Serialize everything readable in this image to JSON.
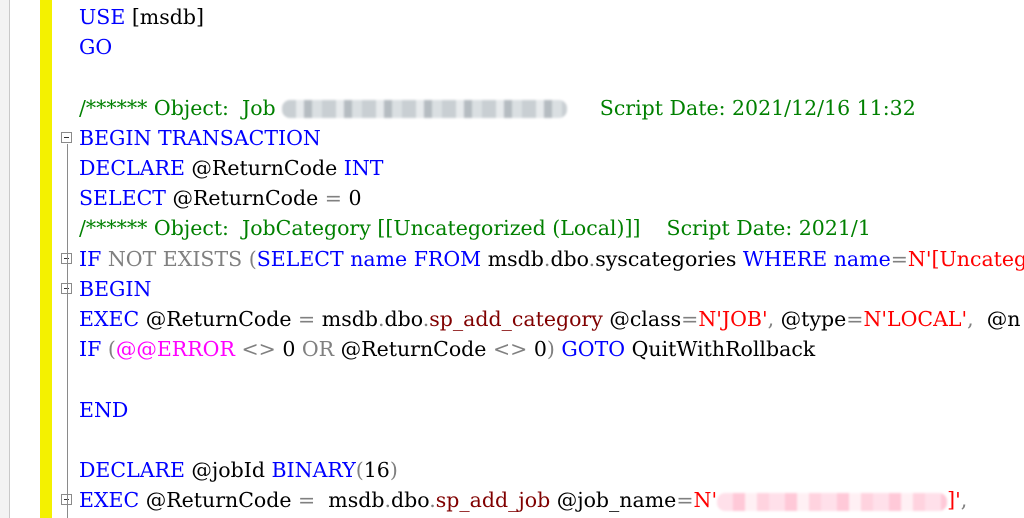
{
  "editor": {
    "lines": [
      {
        "collapse": false,
        "tokens": [
          {
            "text": "USE ",
            "color": "#0000ff"
          },
          {
            "text": "[msdb]",
            "color": "#000000"
          }
        ]
      },
      {
        "collapse": false,
        "tokens": [
          {
            "text": "GO",
            "color": "#0000ff"
          }
        ]
      },
      {
        "collapse": false,
        "tokens": []
      },
      {
        "collapse": false,
        "tokens": [
          {
            "text": "/****** Object:  Job ",
            "color": "#008000"
          },
          {
            "redacted": "gray",
            "width": 285
          },
          {
            "text": "     Script Date: 2021/12/16 11:32",
            "color": "#008000"
          }
        ]
      },
      {
        "collapse": true,
        "tokens": [
          {
            "text": "BEGIN TRANSACTION",
            "color": "#0000ff"
          }
        ]
      },
      {
        "collapse": false,
        "tokens": [
          {
            "text": "DECLARE ",
            "color": "#0000ff"
          },
          {
            "text": "@ReturnCode ",
            "color": "#000000"
          },
          {
            "text": "INT",
            "color": "#0000ff"
          }
        ]
      },
      {
        "collapse": false,
        "tokens": [
          {
            "text": "SELECT ",
            "color": "#0000ff"
          },
          {
            "text": "@ReturnCode ",
            "color": "#000000"
          },
          {
            "text": "= ",
            "color": "#808080"
          },
          {
            "text": "0",
            "color": "#000000"
          }
        ]
      },
      {
        "collapse": false,
        "tokens": [
          {
            "text": "/****** Object:  JobCategory [[Uncategorized (Local)]]    Script Date: 2021/1",
            "color": "#008000"
          }
        ]
      },
      {
        "collapse": true,
        "tokens": [
          {
            "text": "IF ",
            "color": "#0000ff"
          },
          {
            "text": "NOT EXISTS ",
            "color": "#808080"
          },
          {
            "text": "(",
            "color": "#808080"
          },
          {
            "text": "SELECT ",
            "color": "#0000ff"
          },
          {
            "text": "name ",
            "color": "#0000ff"
          },
          {
            "text": "FROM ",
            "color": "#0000ff"
          },
          {
            "text": "msdb",
            "color": "#000000"
          },
          {
            "text": ".",
            "color": "#808080"
          },
          {
            "text": "dbo",
            "color": "#000000"
          },
          {
            "text": ".",
            "color": "#808080"
          },
          {
            "text": "syscategories ",
            "color": "#000000"
          },
          {
            "text": "WHERE ",
            "color": "#0000ff"
          },
          {
            "text": "name",
            "color": "#0000ff"
          },
          {
            "text": "=",
            "color": "#808080"
          },
          {
            "text": "N'[Uncatego",
            "color": "#ff0000"
          }
        ]
      },
      {
        "collapse": true,
        "tokens": [
          {
            "text": "BEGIN",
            "color": "#0000ff"
          }
        ]
      },
      {
        "collapse": false,
        "tokens": [
          {
            "text": "EXEC ",
            "color": "#0000ff"
          },
          {
            "text": "@ReturnCode ",
            "color": "#000000"
          },
          {
            "text": "= ",
            "color": "#808080"
          },
          {
            "text": "msdb",
            "color": "#000000"
          },
          {
            "text": ".",
            "color": "#808080"
          },
          {
            "text": "dbo",
            "color": "#000000"
          },
          {
            "text": ".",
            "color": "#808080"
          },
          {
            "text": "sp_add_category ",
            "color": "#800000"
          },
          {
            "text": "@class",
            "color": "#000000"
          },
          {
            "text": "=",
            "color": "#808080"
          },
          {
            "text": "N'JOB'",
            "color": "#ff0000"
          },
          {
            "text": ", ",
            "color": "#808080"
          },
          {
            "text": "@type",
            "color": "#000000"
          },
          {
            "text": "=",
            "color": "#808080"
          },
          {
            "text": "N'LOCAL'",
            "color": "#ff0000"
          },
          {
            "text": ",  ",
            "color": "#808080"
          },
          {
            "text": "@n",
            "color": "#000000"
          }
        ]
      },
      {
        "collapse": false,
        "tokens": [
          {
            "text": "IF ",
            "color": "#0000ff"
          },
          {
            "text": "(",
            "color": "#808080"
          },
          {
            "text": "@@ERROR ",
            "color": "#ff00ff"
          },
          {
            "text": "<> ",
            "color": "#808080"
          },
          {
            "text": "0 ",
            "color": "#000000"
          },
          {
            "text": "OR ",
            "color": "#808080"
          },
          {
            "text": "@ReturnCode ",
            "color": "#000000"
          },
          {
            "text": "<> ",
            "color": "#808080"
          },
          {
            "text": "0",
            "color": "#000000"
          },
          {
            "text": ") ",
            "color": "#808080"
          },
          {
            "text": "GOTO ",
            "color": "#0000ff"
          },
          {
            "text": "QuitWithRollback",
            "color": "#000000"
          }
        ]
      },
      {
        "collapse": false,
        "tokens": []
      },
      {
        "collapse": false,
        "tokens": [
          {
            "text": "END",
            "color": "#0000ff"
          }
        ]
      },
      {
        "collapse": false,
        "tokens": []
      },
      {
        "collapse": false,
        "tokens": [
          {
            "text": "DECLARE ",
            "color": "#0000ff"
          },
          {
            "text": "@jobId ",
            "color": "#000000"
          },
          {
            "text": "BINARY",
            "color": "#0000ff"
          },
          {
            "text": "(",
            "color": "#808080"
          },
          {
            "text": "16",
            "color": "#000000"
          },
          {
            "text": ")",
            "color": "#808080"
          }
        ]
      },
      {
        "collapse": true,
        "tokens": [
          {
            "text": "EXEC ",
            "color": "#0000ff"
          },
          {
            "text": "@ReturnCode ",
            "color": "#000000"
          },
          {
            "text": "=  ",
            "color": "#808080"
          },
          {
            "text": "msdb",
            "color": "#000000"
          },
          {
            "text": ".",
            "color": "#808080"
          },
          {
            "text": "dbo",
            "color": "#000000"
          },
          {
            "text": ".",
            "color": "#808080"
          },
          {
            "text": "sp_add_job ",
            "color": "#800000"
          },
          {
            "text": "@job_name",
            "color": "#000000"
          },
          {
            "text": "=",
            "color": "#808080"
          },
          {
            "text": "N'",
            "color": "#ff0000"
          },
          {
            "redacted": "pink",
            "width": 230
          },
          {
            "text": "]'",
            "color": "#ff0000"
          },
          {
            "text": ",",
            "color": "#808080"
          }
        ]
      }
    ]
  }
}
